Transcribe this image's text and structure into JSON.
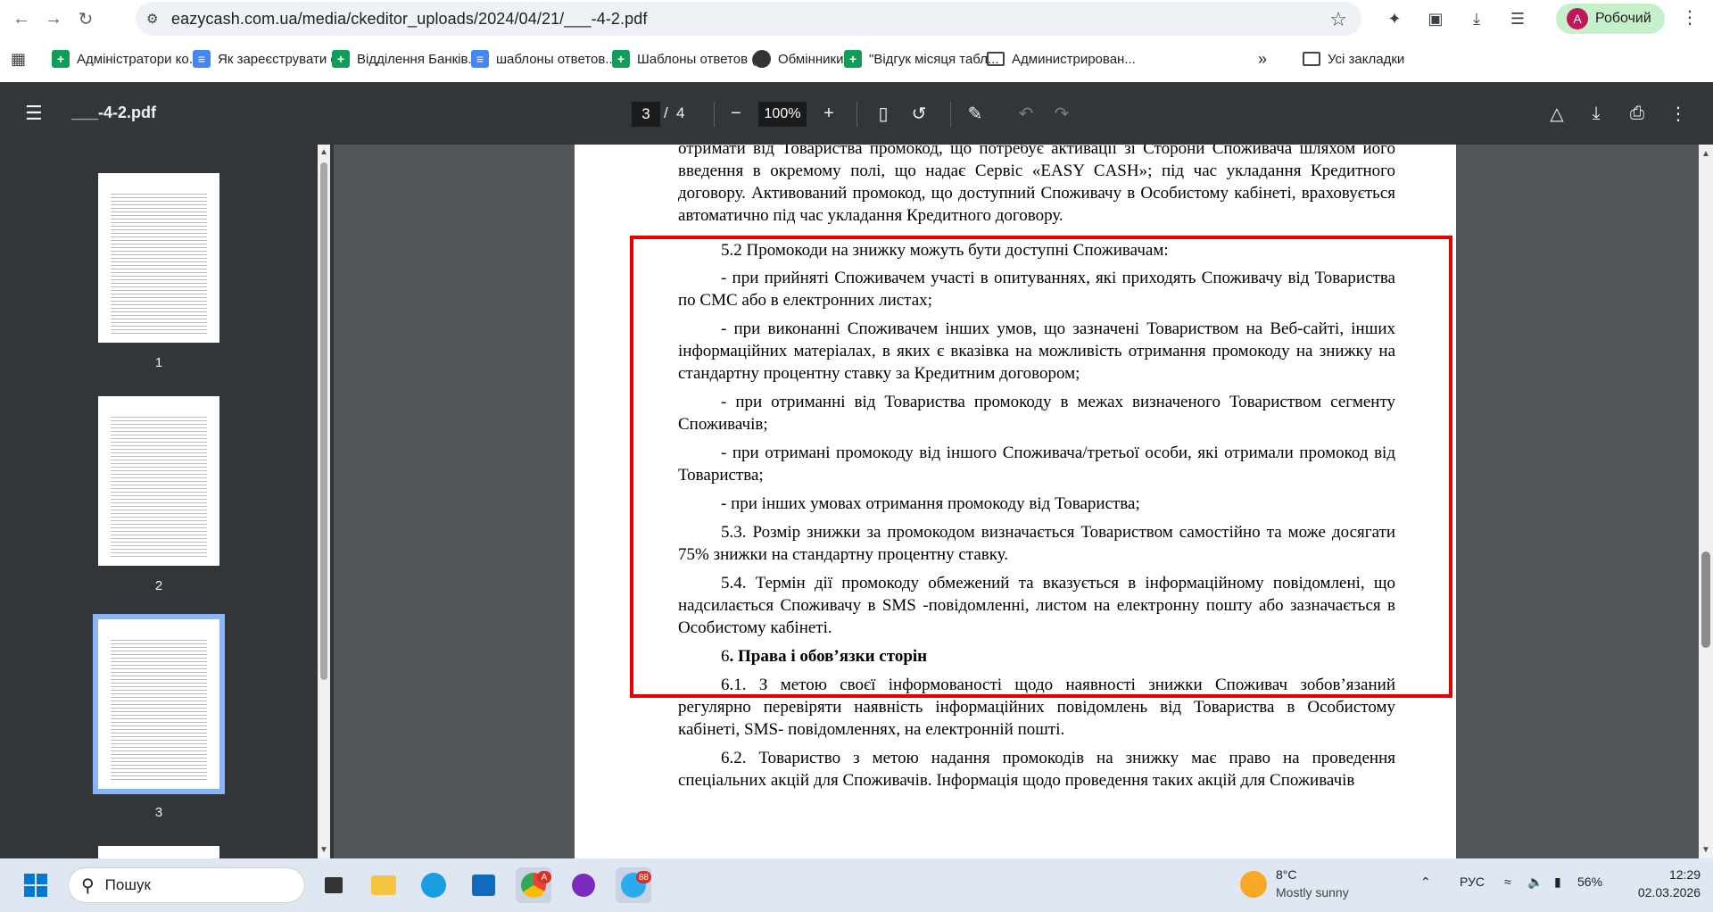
{
  "browser": {
    "url": "eazycash.com.ua/media/ckeditor_uploads/2024/04/21/___-4-2.pdf",
    "profile_initial": "A",
    "profile_name": "Робочий",
    "bookmarks": [
      {
        "label": "Адміністратори ко...",
        "icon": "sheet-icon"
      },
      {
        "label": "Як зареєструвати о...",
        "icon": "doc-icon"
      },
      {
        "label": "Відділення Банків...",
        "icon": "sheet-icon"
      },
      {
        "label": "шаблоны ответов...",
        "icon": "doc-icon"
      },
      {
        "label": "Шаблоны ответов (...",
        "icon": "sheet-icon"
      },
      {
        "label": "Обмінники",
        "icon": "globe-icon"
      },
      {
        "label": "\"Відгук місяця табл...",
        "icon": "sheet-icon"
      },
      {
        "label": "Администрирован...",
        "icon": "folder-icon"
      }
    ],
    "all_bookmarks_label": "Усі закладки"
  },
  "pdf": {
    "title": "___-4-2.pdf",
    "current_page": "3",
    "separator": "/",
    "total_pages": "4",
    "zoom": "100%",
    "thumbnails": [
      "1",
      "2",
      "3"
    ]
  },
  "document": {
    "top_fragment": "отримати від Товариства промокод, що потребує активації зі Сторони Споживача шляхом його введення в окремому полі, що надає Сервіс «EASY CASH»; під час укладання Кредитного договору. Активований промокод, що доступний Споживачу в Особистому кабінеті, враховується автоматично під час укладання Кредитного договору.",
    "p_5_2": "5.2 Промокоди на знижку можуть бути доступні Споживачам:",
    "item_1": "- при прийняті Споживачем участі в опитуваннях, які приходять Споживачу від Товариства по СМС або в електронних листах;",
    "item_2": "- при виконанні Споживачем інших умов, що зазначені Товариством на Веб-сайті, інших інформаційних матеріалах, в яких є вказівка на можливість отримання промокоду на знижку на стандартну процентну ставку за Кредитним договором;",
    "item_3": "- при отриманні від Товариства промокоду в межах визначеного Товариством сегменту Споживачів;",
    "item_4": "- при отримані промокоду від іншого Споживача/третьої особи, які отримали промокод від Товариства;",
    "item_5": "- при інших умовах отримання промокоду від Товариства;",
    "p_5_3": "5.3. Розмір знижки за промокодом визначається Товариством самостійно та може досягати 75% знижки на стандартну процентну ставку.",
    "p_5_4": "5.4. Термін дії промокоду обмежений та вказується в інформаційному повідомлені, що надсилається Споживачу в SMS -повідомленні, листом на електронну пошту або зазначається в Особистому кабінеті.",
    "heading_6_num": "6",
    "heading_6": ". Права і обов’язки сторін",
    "p_6_1": "6.1. З метою своєї інформованості щодо наявності знижки Споживач зобов’язаний регулярно перевіряти наявність інформаційних повідомлень від Товариства в Особистому кабінеті, SMS- повідомленнях, на електронній пошті.",
    "p_6_2": "6.2. Товариство з метою надання промокодів на знижку має право на проведення спеціальних акцій для Споживачів. Інформація щодо проведення таких акцій для Споживачів"
  },
  "taskbar": {
    "search_placeholder": "Пошук",
    "chrome_badge": "A",
    "telegram_badge": "88",
    "weather_temp": "8°C",
    "weather_desc": "Mostly sunny",
    "language": "РУС",
    "battery": "56%",
    "time": "12:29",
    "date": "02.03.2026"
  },
  "colors": {
    "highlight_border": "#e60000",
    "pdf_toolbar": "#323639",
    "viewer_bg": "#525659",
    "profile_bg": "#c5f0c9"
  }
}
